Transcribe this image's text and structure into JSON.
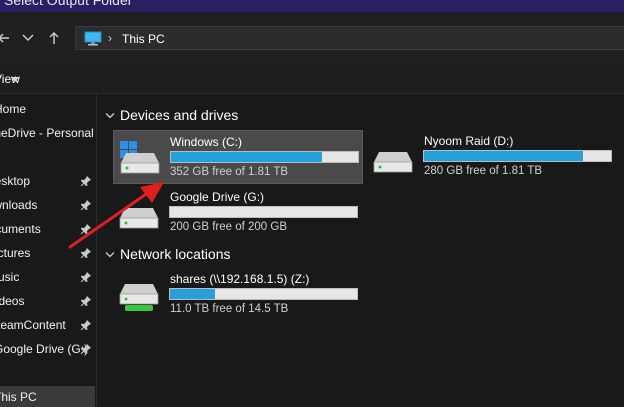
{
  "window": {
    "title": "Select Output Folder"
  },
  "nav": {
    "back_icon": "back-arrow-icon",
    "forward_icon": "forward-arrow-icon",
    "up_icon": "up-arrow-icon",
    "breadcrumb": "This PC"
  },
  "toolbar": {
    "view_label": "View"
  },
  "sidebar": {
    "items": [
      {
        "label": "Home",
        "pinned": false
      },
      {
        "label": "OneDrive - Personal",
        "pinned": false
      },
      {
        "label": "Desktop",
        "pinned": true
      },
      {
        "label": "Downloads",
        "pinned": true
      },
      {
        "label": "Documents",
        "pinned": true
      },
      {
        "label": "Pictures",
        "pinned": true
      },
      {
        "label": "Music",
        "pinned": true
      },
      {
        "label": "Videos",
        "pinned": true
      },
      {
        "label": "SteamContent",
        "pinned": true
      },
      {
        "label": "Google Drive (G:)",
        "pinned": true
      },
      {
        "label": "This PC",
        "pinned": false,
        "selected": true
      }
    ]
  },
  "sections": {
    "devices": "Devices and drives",
    "network": "Network locations"
  },
  "drives": [
    {
      "name": "Windows (C:)",
      "info": "352 GB free of 1.81 TB",
      "used_fraction": 0.81,
      "selected": true
    },
    {
      "name": "Nyoom Raid (D:)",
      "info": "280 GB free of 1.81 TB",
      "used_fraction": 0.85,
      "selected": false
    },
    {
      "name": "Google Drive (G:)",
      "info": "200 GB free of 200 GB",
      "used_fraction": 0.0,
      "selected": false
    }
  ],
  "network_drives": [
    {
      "name": "shares (\\\\192.168.1.5) (Z:)",
      "info": "11.0 TB free of 14.5 TB",
      "used_fraction": 0.24
    }
  ],
  "colors": {
    "accent": "#26a0da",
    "titlebar": "#2b1e62",
    "annotation_arrow": "#e01e1e"
  }
}
